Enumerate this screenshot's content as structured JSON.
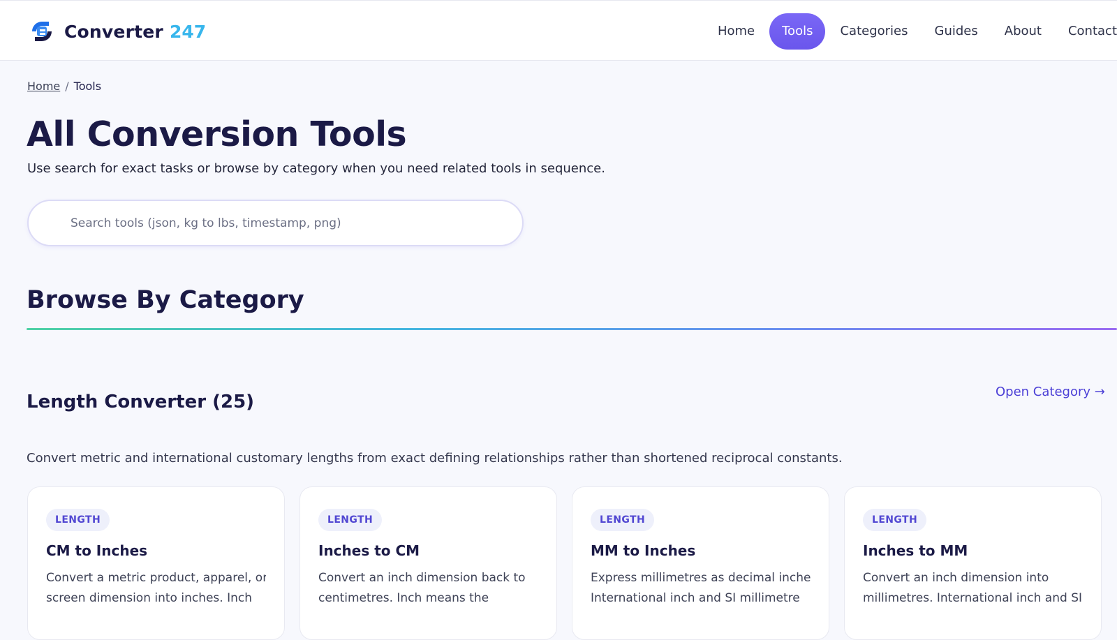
{
  "brand": {
    "name": "Converter",
    "number": "247",
    "accent": "#38b6ec"
  },
  "nav": {
    "items": [
      {
        "label": "Home"
      },
      {
        "label": "Tools",
        "active": true
      },
      {
        "label": "Categories"
      },
      {
        "label": "Guides"
      },
      {
        "label": "About"
      },
      {
        "label": "Contact"
      }
    ],
    "active_color": "#6a56ec"
  },
  "breadcrumb": {
    "home": "Home",
    "separator": "/",
    "current": "Tools"
  },
  "page": {
    "title": "All Conversion Tools",
    "subtitle": "Use search for exact tasks or browse by category when you need related tools in sequence."
  },
  "search": {
    "placeholder": "Search tools (json, kg to lbs, timestamp, png)",
    "value": ""
  },
  "browse": {
    "title": "Browse By Category"
  },
  "category": {
    "title": "Length Converter (25)",
    "link": "Open Category →",
    "description": "Convert metric and international customary lengths from exact defining relationships rather than shortened reciprocal constants."
  },
  "cards": [
    {
      "badge": "LENGTH",
      "title": "CM to Inches",
      "desc_line1": "Convert a metric product, apparel, or",
      "desc_line2": "screen dimension into inches. Inch"
    },
    {
      "badge": "LENGTH",
      "title": "Inches to CM",
      "desc_line1": "Convert an inch dimension back to",
      "desc_line2": "centimetres. Inch means the"
    },
    {
      "badge": "LENGTH",
      "title": "MM to Inches",
      "desc_line1": "Express millimetres as decimal inches.",
      "desc_line2": "International inch and SI millimetre"
    },
    {
      "badge": "LENGTH",
      "title": "Inches to MM",
      "desc_line1": "Convert an inch dimension into",
      "desc_line2": "millimetres. International inch and SI"
    }
  ]
}
